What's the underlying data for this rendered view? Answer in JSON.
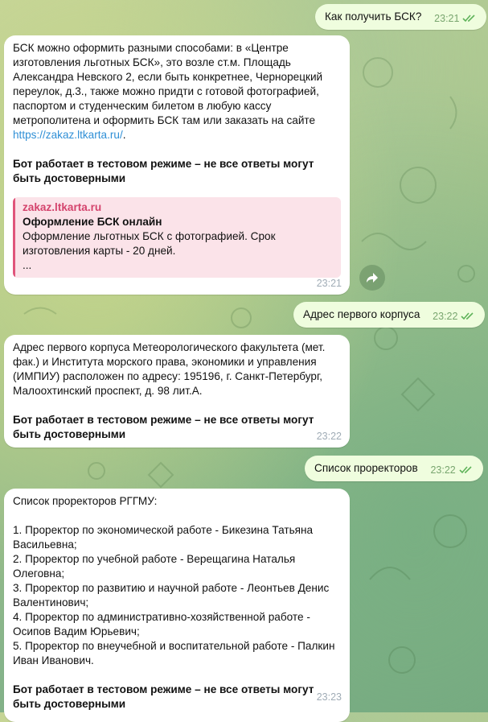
{
  "messages": {
    "q1": {
      "text": "Как получить БСК?",
      "time": "23:21"
    },
    "a1": {
      "text_before": "БСК можно оформить разными способами: в «Центре изготовления льготных БСК», это возле ст.м. Площадь Александра Невского 2, если быть конкретнее, Чернорецкий переулок, д.3., также можно придти с готовой фотографией, паспортом и студенческим билетом в любую кассу метрополитена и оформить БСК там или заказать на сайте ",
      "link": "https://zakaz.ltkarta.ru/",
      "text_after": ".",
      "disclaimer": "Бот работает в тестовом режиме – не все ответы могут быть достоверными",
      "preview": {
        "site": "zakaz.ltkarta.ru",
        "title": "Оформление БСК онлайн",
        "description": "Оформление льготных БСК с фотографией. Срок изготовления карты - 20 дней.",
        "more": "..."
      },
      "time": "23:21"
    },
    "q2": {
      "text": "Адрес первого корпуса",
      "time": "23:22"
    },
    "a2": {
      "text": "Адрес первого корпуса Метеорологического факультета (мет. фак.) и Института морского права, экономики и управления (ИМПИУ) расположен по адресу: 195196, г. Санкт-Петербург, Малоохтинский проспект, д. 98 лит.А.",
      "disclaimer": "Бот работает в тестовом режиме – не все ответы могут быть достоверными",
      "time": "23:22"
    },
    "q3": {
      "text": "Список проректоров",
      "time": "23:22"
    },
    "a3": {
      "heading": "Список проректоров РГГМУ:",
      "items": [
        "1. Проректор по экономической работе - Бикезина Татьяна Васильевна;",
        "2. Проректор по учебной работе - Верещагина Наталья Олеговна;",
        "3. Проректор по развитию и научной работе - Леонтьев Денис Валентинович;",
        "4. Проректор по административно-хозяйственной работе - Осипов Вадим Юрьевич;",
        "5. Проректор по внеучебной и воспитательной работе - Палкин Иван Иванович."
      ],
      "disclaimer": "Бот работает в тестовом режиме – не все ответы могут быть достоверными",
      "time": "23:23"
    }
  },
  "icons": {
    "share": "share-arrow-icon",
    "read": "double-check-icon"
  },
  "colors": {
    "outgoing_bubble": "#effdde",
    "incoming_bubble": "#ffffff",
    "link": "#2f8fd6",
    "preview_accent": "#e0557b"
  }
}
